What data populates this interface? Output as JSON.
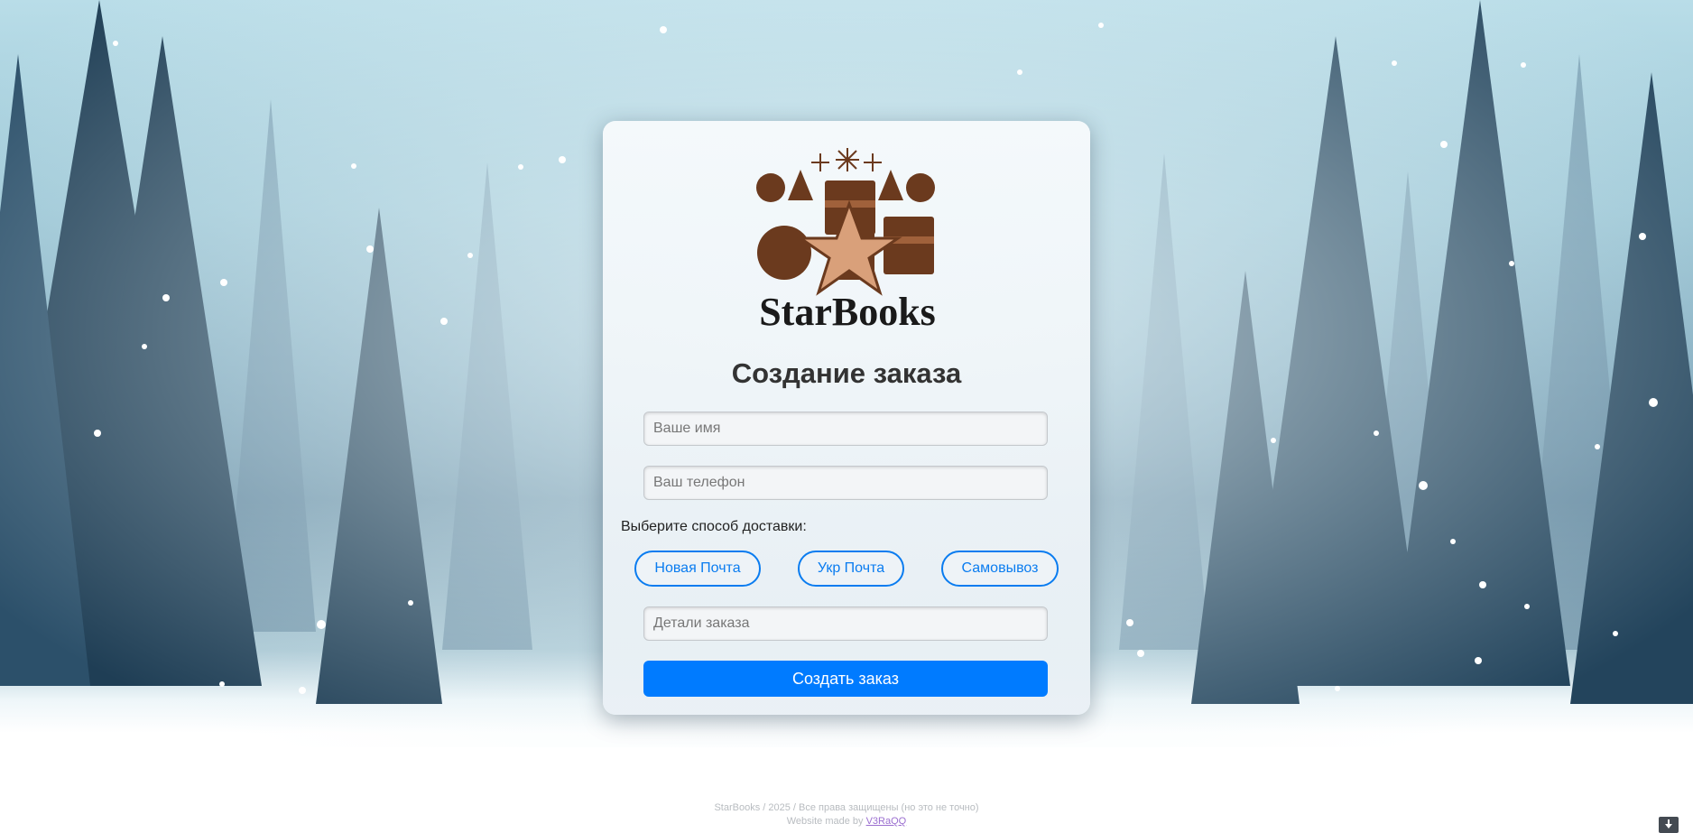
{
  "brand": {
    "logo_text": "StarBooks"
  },
  "form": {
    "title": "Создание заказа",
    "name_placeholder": "Ваше имя",
    "phone_placeholder": "Ваш телефон",
    "delivery_label": "Выберите способ доставки:",
    "delivery_options": [
      "Новая Почта",
      "Укр Почта",
      "Самовывоз"
    ],
    "details_placeholder": "Детали заказа",
    "submit_label": "Создать заказ"
  },
  "footer": {
    "copyright": "StarBooks / 2025 / Все права защищены (но это не точно)",
    "made_by_prefix": "Website made by ",
    "made_by_link": "V3RaQQ"
  },
  "colors": {
    "accent": "#007bff",
    "option_border": "#0a7cf0",
    "logo_brown": "#6b3a1e",
    "title_text": "#333333"
  },
  "icons": [
    "snowflake-icon",
    "star-icon",
    "gift-icon",
    "ornament-icon",
    "tree-icon",
    "download-icon"
  ]
}
